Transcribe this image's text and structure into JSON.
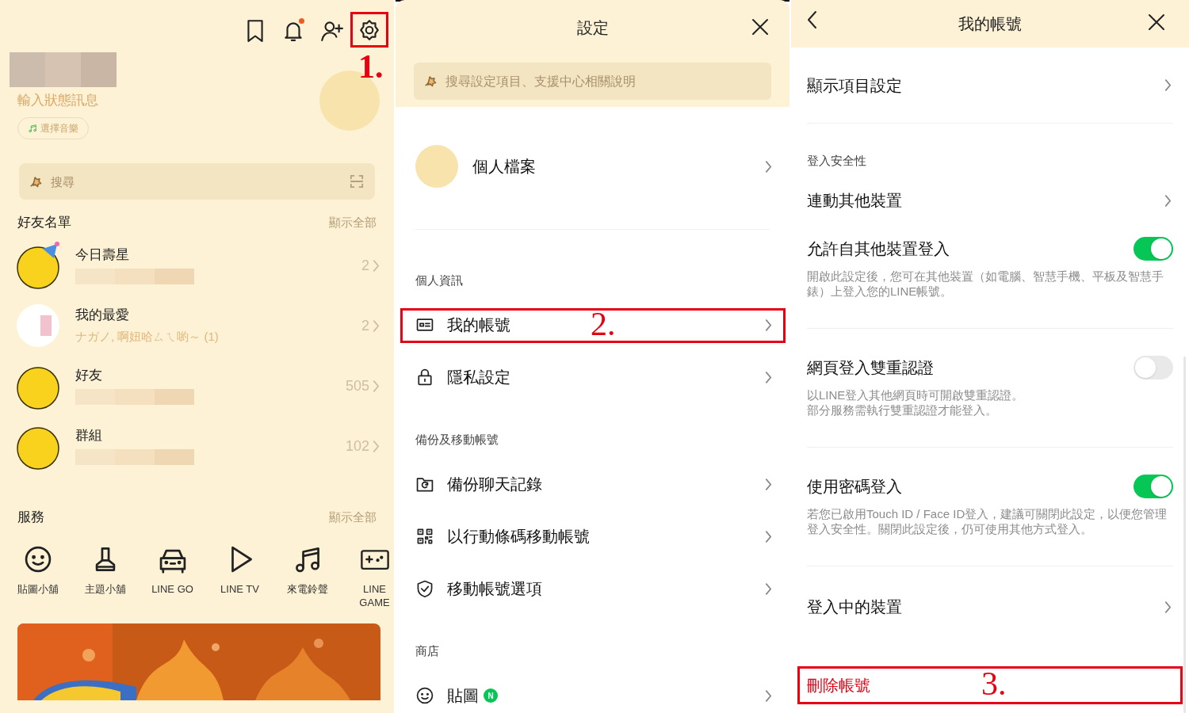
{
  "home_screen": {
    "toolbar_icons": [
      {
        "kind": "bookmark",
        "notification": false,
        "highlighted": false
      },
      {
        "kind": "bell",
        "notification": true,
        "highlighted": false
      },
      {
        "kind": "add_friend",
        "notification": false,
        "highlighted": false
      },
      {
        "kind": "settings",
        "notification": false,
        "highlighted": true
      }
    ],
    "annotation": "1.",
    "status_message": "輸入狀態訊息",
    "music_button": "選擇音樂",
    "search": {
      "placeholder": "搜尋"
    },
    "friends_header": {
      "title": "好友名單",
      "action": "顯示全部"
    },
    "friend_groups": [
      {
        "name": "今日壽星",
        "kind": "smiley",
        "party_hat": true,
        "subtitle_redacted": true,
        "count": "2"
      },
      {
        "name": "我的最愛",
        "kind": "sticker",
        "party_hat": false,
        "subtitle": "ナガノ, 啊妞哈ㄙㄟ喲～ (1)",
        "subtitle_redacted": false,
        "count": "2"
      },
      {
        "name": "好友",
        "kind": "smiley",
        "party_hat": false,
        "subtitle_redacted": true,
        "count": "505"
      },
      {
        "name": "群組",
        "kind": "smiley",
        "party_hat": false,
        "subtitle_redacted": true,
        "count": "102"
      }
    ],
    "services_header": {
      "title": "服務",
      "action": "顯示全部"
    },
    "services": [
      {
        "label": "貼圖小舖",
        "kind": "smiley"
      },
      {
        "label": "主題小舖",
        "kind": "brush"
      },
      {
        "label": "LINE GO",
        "kind": "car"
      },
      {
        "label": "LINE TV",
        "kind": "play"
      },
      {
        "label": "來電鈴聲",
        "kind": "music"
      },
      {
        "label": "LINE GAME",
        "kind": "game"
      }
    ]
  },
  "settings_screen": {
    "title": "設定",
    "search": {
      "placeholder": "搜尋設定項目、支援中心相關說明"
    },
    "profile": {
      "label": "個人檔案"
    },
    "sections": [
      {
        "heading": "個人資訊",
        "items": [
          {
            "label": "我的帳號",
            "kind": "id_card",
            "highlighted": true,
            "annotation": "2.",
            "badge": false
          },
          {
            "label": "隱私設定",
            "kind": "lock",
            "highlighted": false,
            "badge": false
          }
        ]
      },
      {
        "heading": "備份及移動帳號",
        "items": [
          {
            "label": "備份聊天記錄",
            "kind": "folder_sync",
            "highlighted": false,
            "badge": false
          },
          {
            "label": "以行動條碼移動帳號",
            "kind": "qr",
            "highlighted": false,
            "badge": false
          },
          {
            "label": "移動帳號選項",
            "kind": "shield",
            "highlighted": false,
            "badge": false
          }
        ]
      },
      {
        "heading": "商店",
        "items": [
          {
            "label": "貼圖",
            "kind": "smiley",
            "highlighted": false,
            "badge": true,
            "badge_text": "N"
          }
        ]
      }
    ]
  },
  "account_screen": {
    "title": "我的帳號",
    "rows": [
      {
        "kind": "link",
        "label": "顯示項目設定"
      },
      {
        "kind": "section",
        "label": "登入安全性"
      },
      {
        "kind": "link",
        "label": "連動其他裝置"
      },
      {
        "kind": "toggle",
        "label": "允許自其他裝置登入",
        "on": true,
        "description": [
          "開啟此設定後，您可在其他裝置（如電腦、智慧手機、平板及智慧手錶）上登入您的LINE帳號。"
        ]
      },
      {
        "kind": "toggle",
        "label": "網頁登入雙重認證",
        "on": false,
        "description": [
          "以LINE登入其他網頁時可開啟雙重認證。",
          "部分服務需執行雙重認證才能登入。"
        ]
      },
      {
        "kind": "toggle",
        "label": "使用密碼登入",
        "on": true,
        "description": [
          "若您已啟用Touch ID / Face ID登入，建議可關閉此設定，以便您管理登入安全性。關閉此設定後，仍可使用其他方式登入。"
        ]
      },
      {
        "kind": "link",
        "label": "登入中的裝置"
      },
      {
        "kind": "danger",
        "label": "刪除帳號",
        "highlighted": true,
        "annotation": "3."
      }
    ]
  }
}
